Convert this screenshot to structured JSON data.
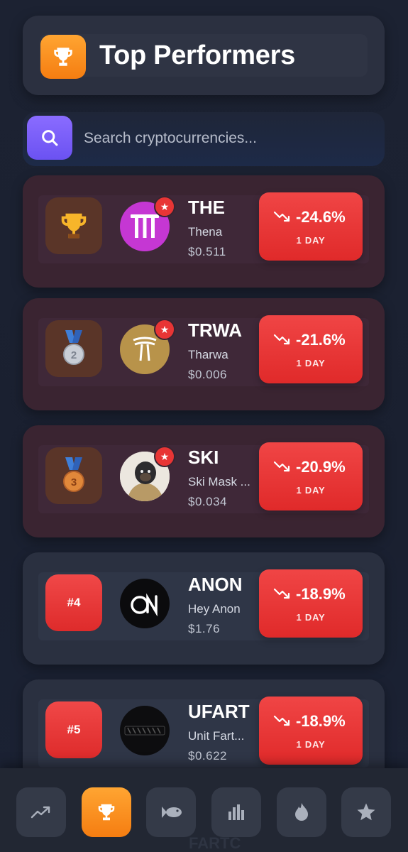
{
  "header": {
    "title": "Top Performers",
    "icon": "trophy-icon"
  },
  "search": {
    "placeholder": "Search cryptocurrencies...",
    "icon": "search-icon"
  },
  "performers": [
    {
      "rank": "1",
      "rank_icon": "gold-trophy-icon",
      "symbol": "THE",
      "name": "Thena",
      "price": "$0.511",
      "change": "-24.6%",
      "period": "1 DAY",
      "favorite": true
    },
    {
      "rank": "2",
      "rank_icon": "silver-medal-icon",
      "symbol": "TRWA",
      "name": "Tharwa",
      "price": "$0.006",
      "change": "-21.6%",
      "period": "1 DAY",
      "favorite": true
    },
    {
      "rank": "3",
      "rank_icon": "bronze-medal-icon",
      "symbol": "SKI",
      "name": "Ski Mask ...",
      "price": "$0.034",
      "change": "-20.9%",
      "period": "1 DAY",
      "favorite": true
    },
    {
      "rank": "#4",
      "symbol": "ANON",
      "name": "Hey Anon",
      "price": "$1.76",
      "change": "-18.9%",
      "period": "1 DAY",
      "favorite": false
    },
    {
      "rank": "#5",
      "symbol": "UFART",
      "name": "Unit Fart...",
      "price": "$0.622",
      "change": "-18.9%",
      "period": "1 DAY",
      "favorite": false
    }
  ],
  "bottom_nav": {
    "items": [
      "trending-icon",
      "trophy-icon",
      "fish-icon",
      "bar-chart-icon",
      "flame-icon",
      "star-icon"
    ],
    "active": "trophy-icon",
    "behind_text": "FARTC"
  },
  "colors": {
    "accent_orange": "#f57d11",
    "search_purple": "#6b52f2",
    "negative_red": "#e02a2a",
    "card_top": "#3a2431",
    "card_regular": "#2a3040"
  }
}
